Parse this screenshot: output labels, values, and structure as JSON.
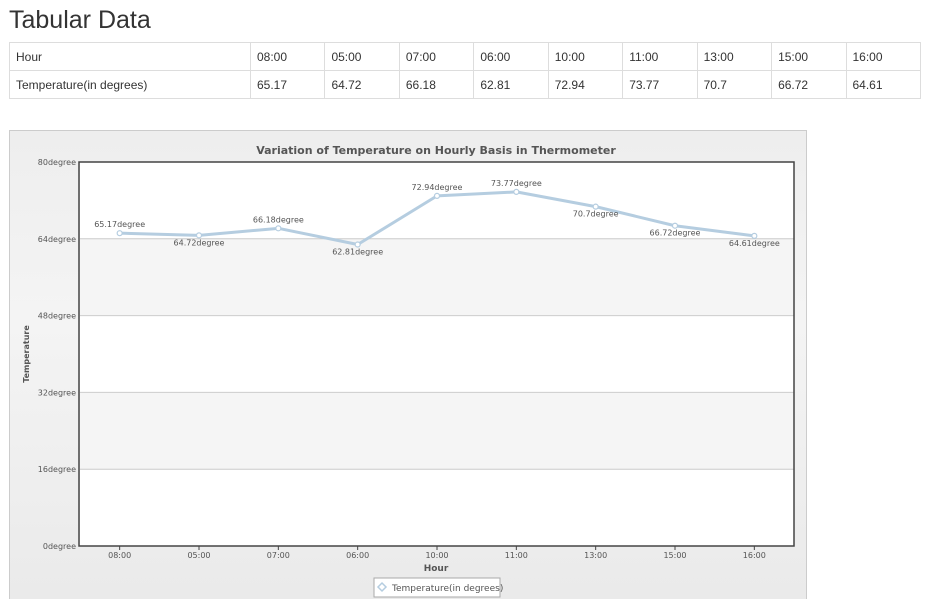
{
  "page": {
    "title": "Tabular Data"
  },
  "table": {
    "rows": [
      {
        "header": "Hour",
        "cells": [
          "08:00",
          "05:00",
          "07:00",
          "06:00",
          "10:00",
          "11:00",
          "13:00",
          "15:00",
          "16:00"
        ]
      },
      {
        "header": "Temperature(in degrees)",
        "cells": [
          "65.17",
          "64.72",
          "66.18",
          "62.81",
          "72.94",
          "73.77",
          "70.7",
          "66.72",
          "64.61"
        ]
      }
    ]
  },
  "chart_data": {
    "type": "line",
    "title": "Variation of Temperature on Hourly Basis in Thermometer",
    "xlabel": "Hour",
    "ylabel": "Temperature",
    "categories": [
      "08:00",
      "05:00",
      "07:00",
      "06:00",
      "10:00",
      "11:00",
      "13:00",
      "15:00",
      "16:00"
    ],
    "series": [
      {
        "name": "Temperature(in degrees)",
        "values": [
          65.17,
          64.72,
          66.18,
          62.81,
          72.94,
          73.77,
          70.7,
          66.72,
          64.61
        ],
        "color": "#b5cde0"
      }
    ],
    "value_suffix": "degree",
    "data_labels": [
      "65.17degree",
      "64.72degree",
      "66.18degree",
      "62.81degree",
      "72.94degree",
      "73.77degree",
      "70.7degree",
      "66.72degree",
      "64.61degree"
    ],
    "ylim": [
      0,
      80
    ],
    "yticks": [
      0,
      16,
      32,
      48,
      64,
      80
    ],
    "ytick_labels": [
      "0degree",
      "16degree",
      "32degree",
      "48degree",
      "64degree",
      "80degree"
    ],
    "grid": true,
    "legend_position": "bottom-center",
    "colors": {
      "band": "#f5f5f5",
      "grid": "#cccccc",
      "text": "#555555"
    }
  }
}
